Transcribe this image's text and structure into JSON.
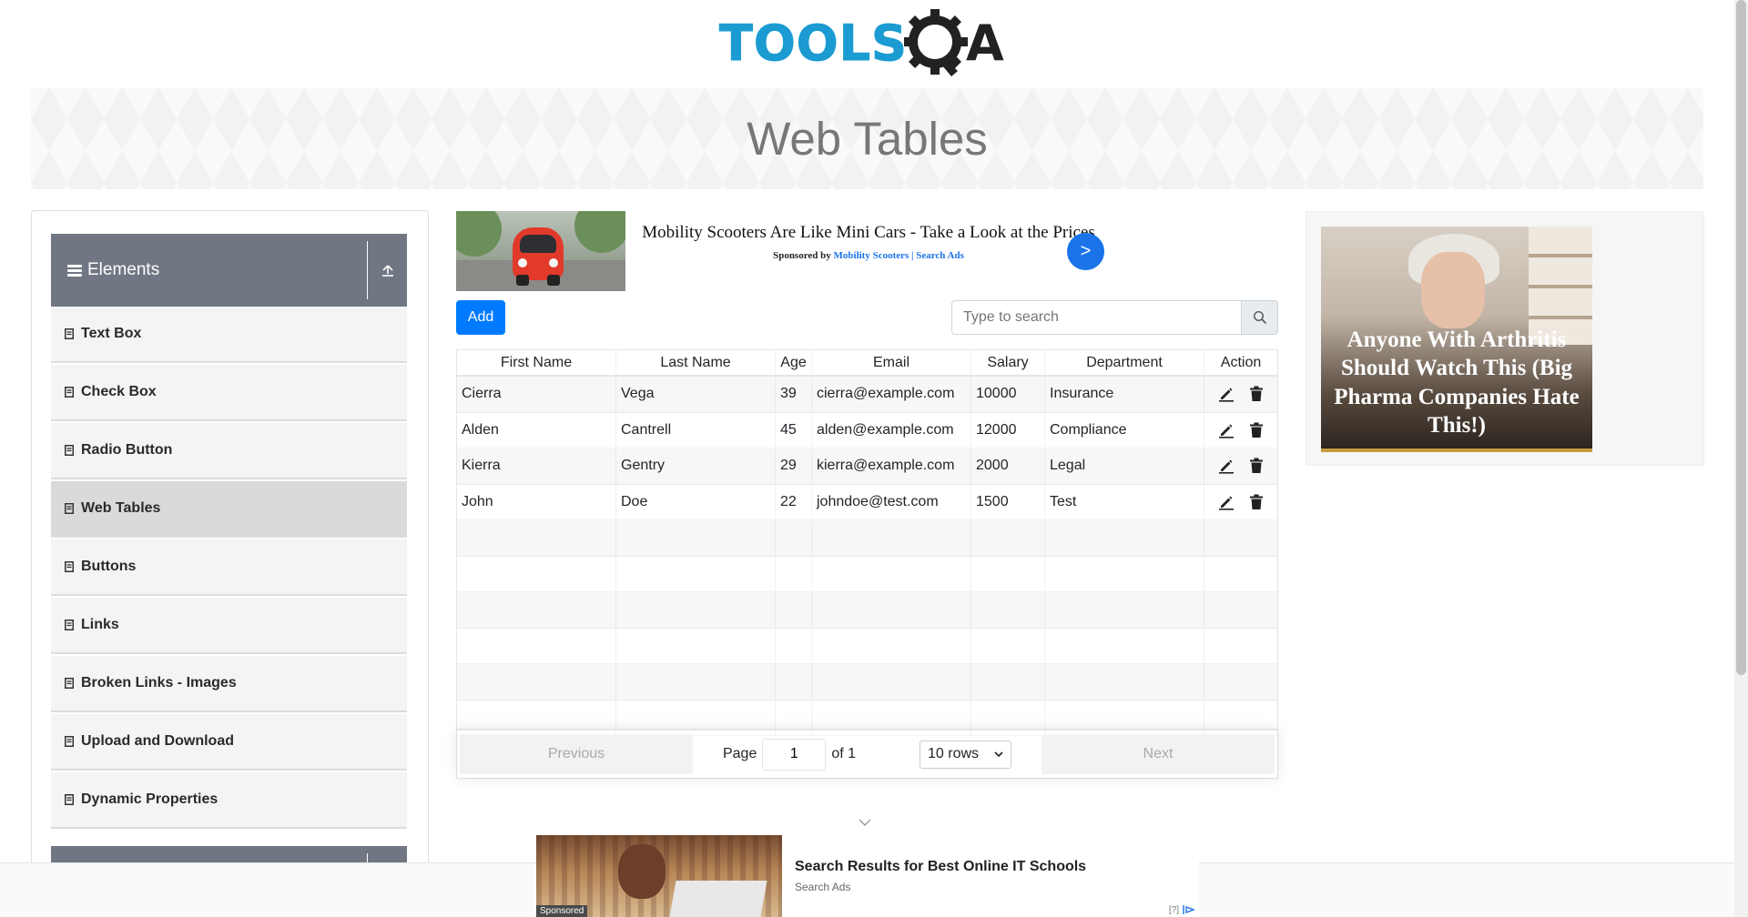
{
  "logo": {
    "text_tools": "TOOLS",
    "text_q": "Q",
    "text_a": "A"
  },
  "banner": {
    "title": "Web Tables"
  },
  "sidebar": {
    "group_title": "Elements",
    "items": [
      {
        "label": "Text Box",
        "active": false
      },
      {
        "label": "Check Box",
        "active": false
      },
      {
        "label": "Radio Button",
        "active": false
      },
      {
        "label": "Web Tables",
        "active": true
      },
      {
        "label": "Buttons",
        "active": false
      },
      {
        "label": "Links",
        "active": false
      },
      {
        "label": "Broken Links - Images",
        "active": false
      },
      {
        "label": "Upload and Download",
        "active": false
      },
      {
        "label": "Dynamic Properties",
        "active": false
      }
    ]
  },
  "ad_top": {
    "headline": "Mobility Scooters Are Like Mini Cars - Take a Look at the Prices",
    "sponsor_prefix": "Sponsored by ",
    "sponsor_name": "Mobility Scooters | Search Ads",
    "go_label": ">"
  },
  "toolbar": {
    "add_label": "Add",
    "search_placeholder": "Type to search"
  },
  "table": {
    "headers": [
      "First Name",
      "Last Name",
      "Age",
      "Email",
      "Salary",
      "Department",
      "Action"
    ],
    "rows": [
      [
        "Cierra",
        "Vega",
        "39",
        "cierra@example.com",
        "10000",
        "Insurance"
      ],
      [
        "Alden",
        "Cantrell",
        "45",
        "alden@example.com",
        "12000",
        "Compliance"
      ],
      [
        "Kierra",
        "Gentry",
        "29",
        "kierra@example.com",
        "2000",
        "Legal"
      ],
      [
        "John",
        "Doe",
        "22",
        "johndoe@test.com",
        "1500",
        "Test"
      ]
    ]
  },
  "pagination": {
    "previous_label": "Previous",
    "next_label": "Next",
    "page_label": "Page",
    "page_value": "1",
    "of_label": "of 1",
    "rows_label": "10 rows"
  },
  "right_ad": {
    "text": "Anyone With Arthritis Should Watch This (Big Pharma Companies Hate This!)"
  },
  "bottom_ad": {
    "headline": "Search Results for Best Online IT Schools",
    "source": "Search Ads",
    "sponsored_tag": "Sponsored",
    "info_label": "[?]"
  },
  "colors": {
    "accent": "#007bff",
    "sidebar_header": "#707783",
    "logo_blue": "#1b9bd1"
  }
}
